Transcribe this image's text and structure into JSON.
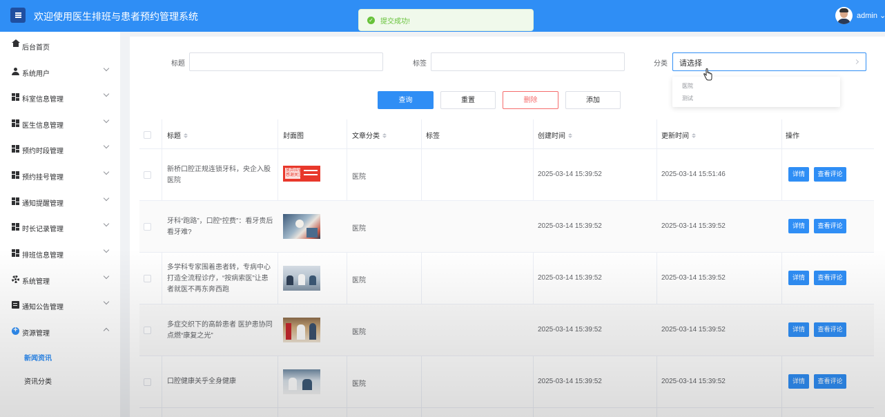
{
  "header": {
    "title": "欢迎使用医生排班与患者预约管理系统",
    "user_name": "admin"
  },
  "toast": {
    "message": "提交成功!"
  },
  "sidebar": {
    "items": [
      {
        "label": "后台首页",
        "icon": "home-icon"
      },
      {
        "label": "系统用户",
        "icon": "user-icon"
      },
      {
        "label": "科室信息管理",
        "icon": "grid-icon"
      },
      {
        "label": "医生信息管理",
        "icon": "grid-icon"
      },
      {
        "label": "预约时段管理",
        "icon": "grid-icon"
      },
      {
        "label": "预约挂号管理",
        "icon": "grid-icon"
      },
      {
        "label": "通知提醒管理",
        "icon": "grid-icon"
      },
      {
        "label": "时长记录管理",
        "icon": "grid-icon"
      },
      {
        "label": "排班信息管理",
        "icon": "grid-icon"
      },
      {
        "label": "系统管理",
        "icon": "gear-icon"
      },
      {
        "label": "通知公告管理",
        "icon": "document-icon"
      },
      {
        "label": "资源管理",
        "icon": "plus-circle-icon"
      }
    ],
    "sub_items": [
      {
        "label": "新闻资讯",
        "active": true
      },
      {
        "label": "资讯分类",
        "active": false
      }
    ]
  },
  "search": {
    "title_label": "标题",
    "tag_label": "标签",
    "category_label": "分类",
    "category_placeholder": "请选择",
    "category_options": [
      "医院",
      "测试"
    ]
  },
  "actions": {
    "query": "查询",
    "reset": "重置",
    "delete": "删除",
    "add": "添加"
  },
  "table": {
    "columns": [
      "标题",
      "封面图",
      "文章分类",
      "标签",
      "创建时间",
      "更新时间",
      "操作"
    ],
    "detail_label": "详情",
    "comments_label": "查看评论",
    "rows": [
      {
        "title": "新桥口腔正规连锁牙科，央企入股医院",
        "category": "医院",
        "tag": "",
        "created": "2025-03-14 15:39:52",
        "updated": "2025-03-14 15:51:46",
        "thumb_text": "放弃应征 感谢关注"
      },
      {
        "title": "牙科“跑路”，口腔“控费”：看牙贵后看牙难?",
        "category": "医院",
        "tag": "",
        "created": "2025-03-14 15:39:52",
        "updated": "2025-03-14 15:39:52"
      },
      {
        "title": "多学科专家围着患者转，专病中心打造全流程诊疗，“按病索医”让患者就医不再东奔西跑",
        "category": "医院",
        "tag": "",
        "created": "2025-03-14 15:39:52",
        "updated": "2025-03-14 15:39:52"
      },
      {
        "title": "多症交织下的高龄患者 医护患协同点燃“康复之光”",
        "category": "医院",
        "tag": "",
        "created": "2025-03-14 15:39:52",
        "updated": "2025-03-14 15:39:52"
      },
      {
        "title": "口腔健康关乎全身健康",
        "category": "医院",
        "tag": "",
        "created": "2025-03-14 15:39:52",
        "updated": "2025-03-14 15:39:52"
      }
    ]
  },
  "colors": {
    "primary": "#2f8ef5",
    "danger": "#f56c6c",
    "success": "#67c23a",
    "header_bg": "#2f8ef5"
  }
}
